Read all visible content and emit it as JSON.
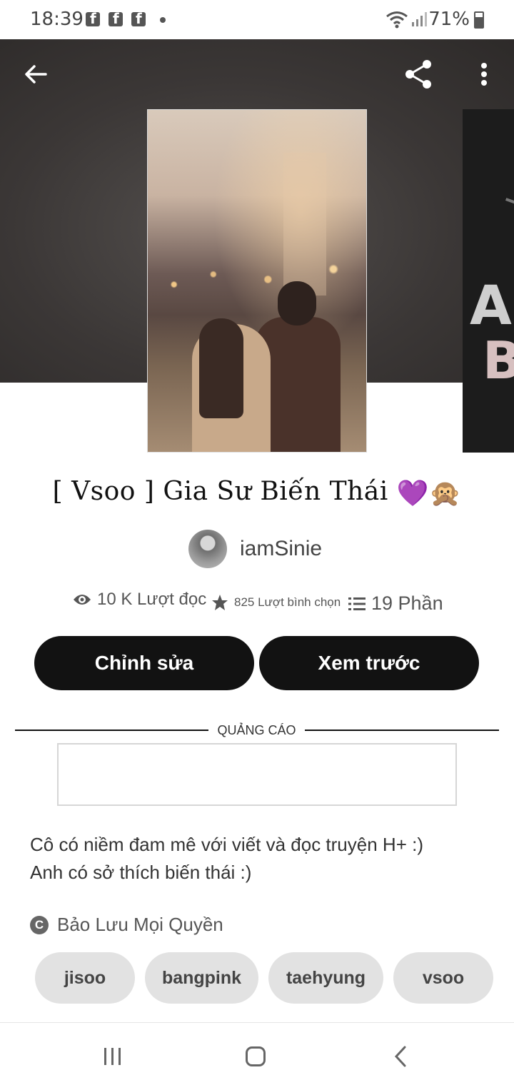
{
  "status_bar": {
    "time": "18:39",
    "battery": "71%",
    "icons": [
      "facebook-icon",
      "facebook-icon",
      "facebook-icon",
      "notification-dot-icon",
      "wifi-icon",
      "signal-icon",
      "battery-icon"
    ]
  },
  "header": {
    "icons": [
      "back-arrow-icon",
      "share-icon",
      "more-vert-icon"
    ]
  },
  "cover_side": {
    "letter_a": "A",
    "letter_b": "B"
  },
  "story": {
    "title": "[ Vsoo ] Gia Sư Biến Thái",
    "title_emoji": "💜🙊",
    "author": "iamSinie",
    "stats": {
      "reads": "10 K Lượt đọc",
      "votes": "825 Lượt bình chọn",
      "parts": "19 Phần"
    },
    "buttons": {
      "edit": "Chỉnh sửa",
      "preview": "Xem trước"
    },
    "ad_label": "QUẢNG CÁO",
    "description": [
      "Cô có niềm đam mê với viết và đọc truyện H+ :)",
      "Anh có sở thích biến thái :)"
    ],
    "copyright": "Bảo Lưu Mọi Quyền",
    "copyright_symbol": "C",
    "tags": [
      "jisoo",
      "bangpink",
      "taehyung",
      "vsoo"
    ]
  },
  "nav": {
    "icons": [
      "recents-icon",
      "home-icon",
      "back-icon"
    ]
  }
}
